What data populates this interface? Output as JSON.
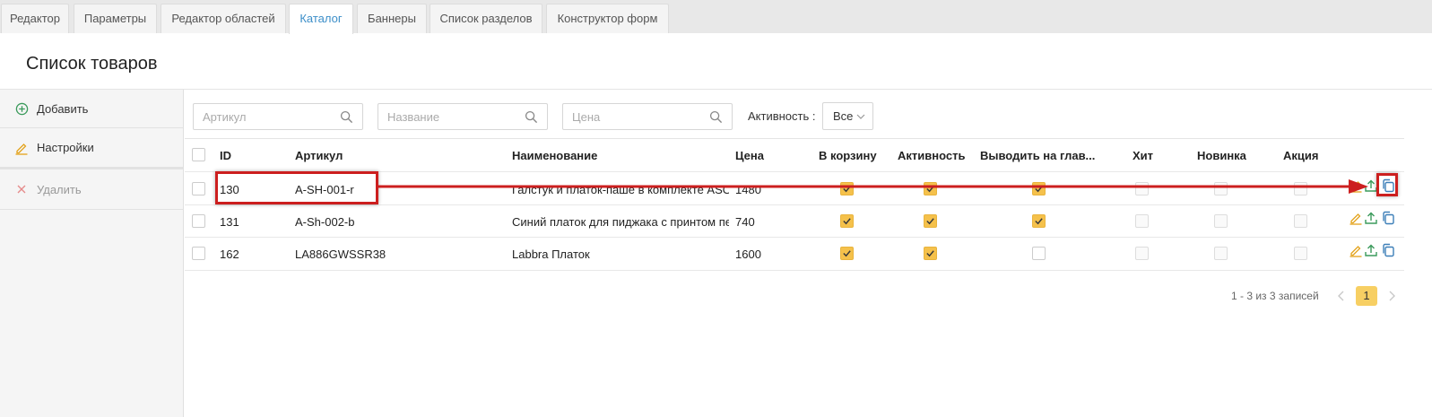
{
  "tabs": [
    {
      "label": "Редактор"
    },
    {
      "label": "Параметры"
    },
    {
      "label": "Редактор областей"
    },
    {
      "label": "Каталог",
      "active": true
    },
    {
      "label": "Баннеры"
    },
    {
      "label": "Список разделов"
    },
    {
      "label": "Конструктор форм"
    }
  ],
  "page": {
    "title": "Список товаров"
  },
  "sidebar": {
    "add_label": "Добавить",
    "settings_label": "Настройки",
    "delete_label": "Удалить"
  },
  "filters": {
    "article_placeholder": "Артикул",
    "name_placeholder": "Название",
    "price_placeholder": "Цена",
    "activity_label": "Активность :",
    "activity_value": "Все"
  },
  "table": {
    "headers": {
      "id": "ID",
      "article": "Артикул",
      "name": "Наименование",
      "price": "Цена",
      "cart": "В корзину",
      "active": "Активность",
      "main": "Выводить на глав...",
      "hit": "Хит",
      "new": "Новинка",
      "sale": "Акция"
    },
    "rows": [
      {
        "id": "130",
        "article": "A-SH-001-r",
        "name": "Галстук и платок-паше в комплекте ASOS",
        "price": "1480",
        "cart": true,
        "active": true,
        "main": true,
        "hit": false,
        "new": false,
        "sale": false
      },
      {
        "id": "131",
        "article": "A-Sh-002-b",
        "name": "Синий платок для пиджака с принтом пейсли",
        "price": "740",
        "cart": true,
        "active": true,
        "main": true,
        "hit": false,
        "new": false,
        "sale": false
      },
      {
        "id": "162",
        "article": "LA886GWSSR38",
        "name": "Labbra Платок",
        "price": "1600",
        "cart": true,
        "active": true,
        "main": false,
        "hit": false,
        "new": false,
        "sale": false
      }
    ]
  },
  "pager": {
    "info": "1 - 3 из 3 записей",
    "current_page": "1"
  },
  "colors": {
    "accent": "#f5c14b",
    "tab_active": "#3d8fc9",
    "annotation": "#cc1f1f",
    "edit_icon": "#e3a21a",
    "upload_icon": "#3a9a5b",
    "copy_icon": "#3d7fb8"
  },
  "icons": {
    "add": "plus-circle-icon",
    "settings": "pencil-icon",
    "delete": "x-icon",
    "search": "search-icon",
    "edit": "pencil-icon",
    "upload": "upload-icon",
    "copy": "copy-icon"
  }
}
